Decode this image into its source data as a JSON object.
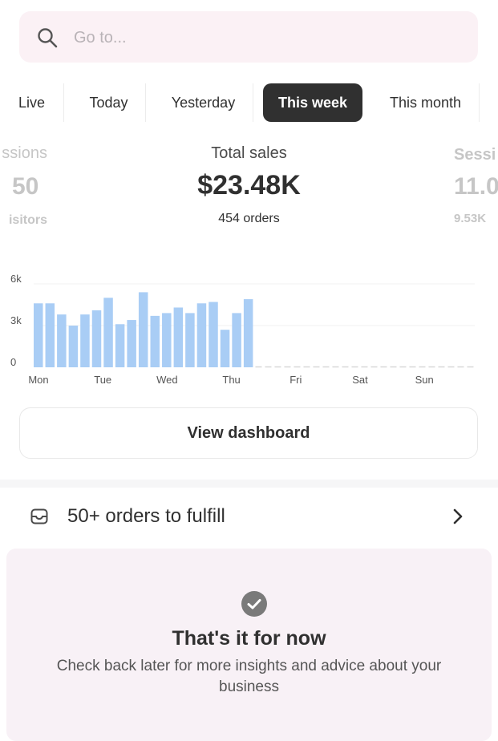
{
  "search": {
    "placeholder": "Go to..."
  },
  "tabs": [
    {
      "label": "Live",
      "active": false
    },
    {
      "label": "Today",
      "active": false
    },
    {
      "label": "Yesterday",
      "active": false
    },
    {
      "label": "This week",
      "active": true
    },
    {
      "label": "This month",
      "active": false
    }
  ],
  "metrics": {
    "left": {
      "label": "ssions",
      "value": "50",
      "sub": "isitors"
    },
    "main": {
      "label": "Total sales",
      "value": "$23.48K",
      "sub": "454 orders"
    },
    "right": {
      "label": "Sessi",
      "value": "11.0",
      "sub": "9.53K"
    }
  },
  "chart_data": {
    "type": "bar",
    "x_ticks": [
      "Mon",
      "Tue",
      "Wed",
      "Thu",
      "Fri",
      "Sat",
      "Sun"
    ],
    "y_ticks": [
      "6k",
      "3k",
      "0"
    ],
    "ylim": [
      0,
      6000
    ],
    "values": [
      4600,
      4600,
      3800,
      3000,
      3800,
      4100,
      5000,
      3100,
      3400,
      5400,
      3700,
      3900,
      4300,
      3900,
      4600,
      4700,
      2700,
      3900,
      4900
    ],
    "bar_color": "#a9cdf5",
    "grid": true
  },
  "dashboard_button": {
    "label": "View dashboard"
  },
  "orders": {
    "label": "50+ orders to fulfill"
  },
  "info_card": {
    "title": "That's it for now",
    "description": "Check back later for more insights and advice about your business"
  }
}
